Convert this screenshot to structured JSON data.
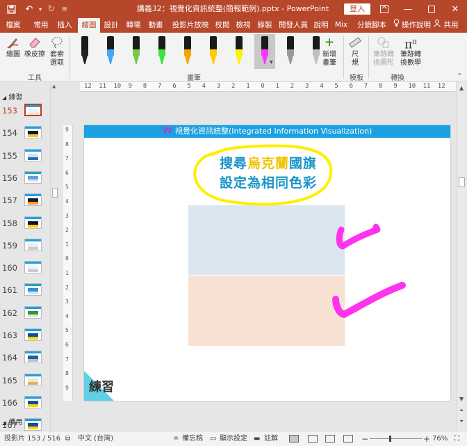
{
  "window": {
    "title": "講義32：視覺化資訊統整(簡報範例).pptx  -  PowerPoint",
    "login_label": "登入"
  },
  "tabs": [
    {
      "label": "檔案",
      "active": false
    },
    {
      "label": "常用",
      "active": false
    },
    {
      "label": "插入",
      "active": false
    },
    {
      "label": "繪圖",
      "active": true
    },
    {
      "label": "設計",
      "active": false
    },
    {
      "label": "轉場",
      "active": false
    },
    {
      "label": "動畫",
      "active": false
    },
    {
      "label": "投影片放映",
      "active": false
    },
    {
      "label": "校閱",
      "active": false
    },
    {
      "label": "檢視",
      "active": false
    },
    {
      "label": "錄製",
      "active": false
    },
    {
      "label": "開發人員",
      "active": false
    },
    {
      "label": "說明",
      "active": false
    },
    {
      "label": "Mix",
      "active": false
    },
    {
      "label": "分鏡腳本",
      "active": false
    },
    {
      "label": "操作說明",
      "active": false
    },
    {
      "label": "共用",
      "active": false
    }
  ],
  "ribbon": {
    "tools": {
      "group_label": "工具",
      "draw_label": "繪圖",
      "eraser_label": "橡皮擦",
      "lasso_label": "套索選取"
    },
    "pens": {
      "group_label": "畫筆",
      "items": [
        {
          "color": "#222222",
          "selected": false
        },
        {
          "color": "#3fa9f5",
          "selected": false
        },
        {
          "color": "#7ac943",
          "selected": false
        },
        {
          "color": "#39e639",
          "selected": false
        },
        {
          "color": "#f7a600",
          "selected": false
        },
        {
          "color": "#ffcc00",
          "selected": false
        },
        {
          "color": "#fff200",
          "selected": false
        },
        {
          "color": "#ff33ff",
          "selected": true
        },
        {
          "color": "#999999",
          "selected": false
        },
        {
          "color": "#c0c0c0",
          "selected": false
        }
      ],
      "add_pen_label": "新增畫筆"
    },
    "stencils": {
      "group_label": "模板",
      "ruler_label": "尺規"
    },
    "convert": {
      "group_label": "轉換",
      "ink_to_shape_label": "筆跡轉換圖形",
      "ink_to_math_label": "筆跡轉換數學"
    }
  },
  "thumbnails": {
    "sections": [
      "練習",
      "備用"
    ],
    "slides": [
      {
        "number": "153",
        "current": true
      },
      {
        "number": "154",
        "current": false
      },
      {
        "number": "155",
        "current": false
      },
      {
        "number": "156",
        "current": false
      },
      {
        "number": "157",
        "current": false
      },
      {
        "number": "158",
        "current": false
      },
      {
        "number": "159",
        "current": false
      },
      {
        "number": "160",
        "current": false
      },
      {
        "number": "161",
        "current": false
      },
      {
        "number": "162",
        "current": false
      },
      {
        "number": "163",
        "current": false
      },
      {
        "number": "164",
        "current": false
      },
      {
        "number": "165",
        "current": false
      },
      {
        "number": "166",
        "current": false
      },
      {
        "number": "167",
        "current": false
      }
    ]
  },
  "ruler": {
    "horizontal": [
      "12",
      "11",
      "10",
      "9",
      "8",
      "7",
      "6",
      "5",
      "4",
      "3",
      "2",
      "1",
      "0",
      "1",
      "2",
      "3",
      "4",
      "5",
      "6",
      "7",
      "8",
      "9",
      "10",
      "11",
      "12"
    ],
    "vertical": [
      "9",
      "8",
      "7",
      "6",
      "5",
      "4",
      "3",
      "2",
      "1",
      "0",
      "1",
      "2",
      "3",
      "4",
      "5",
      "6",
      "7",
      "8",
      "9"
    ]
  },
  "slide": {
    "header_logo": "W",
    "header_text": "視覺化資訊統整(Integrated Information Visualization)",
    "title_line1_a": "搜尋",
    "title_line1_b": "烏克蘭",
    "title_line1_c": "國旗",
    "title_line2": "設定為相同色彩",
    "practice_label": "練習",
    "ink_colors": {
      "highlight": "#ffee00",
      "check": "#ff33ee"
    },
    "flag_colors": {
      "top": "#dce6f1",
      "bottom": "#f7e1d2"
    }
  },
  "status": {
    "slide_info": "投影片 153 / 516",
    "language": "中文 (台灣)",
    "notes_label": "備忘稿",
    "display_settings_label": "顯示設定",
    "comments_label": "註解",
    "zoom_percent": "76%",
    "zoom_level": 0.76
  }
}
